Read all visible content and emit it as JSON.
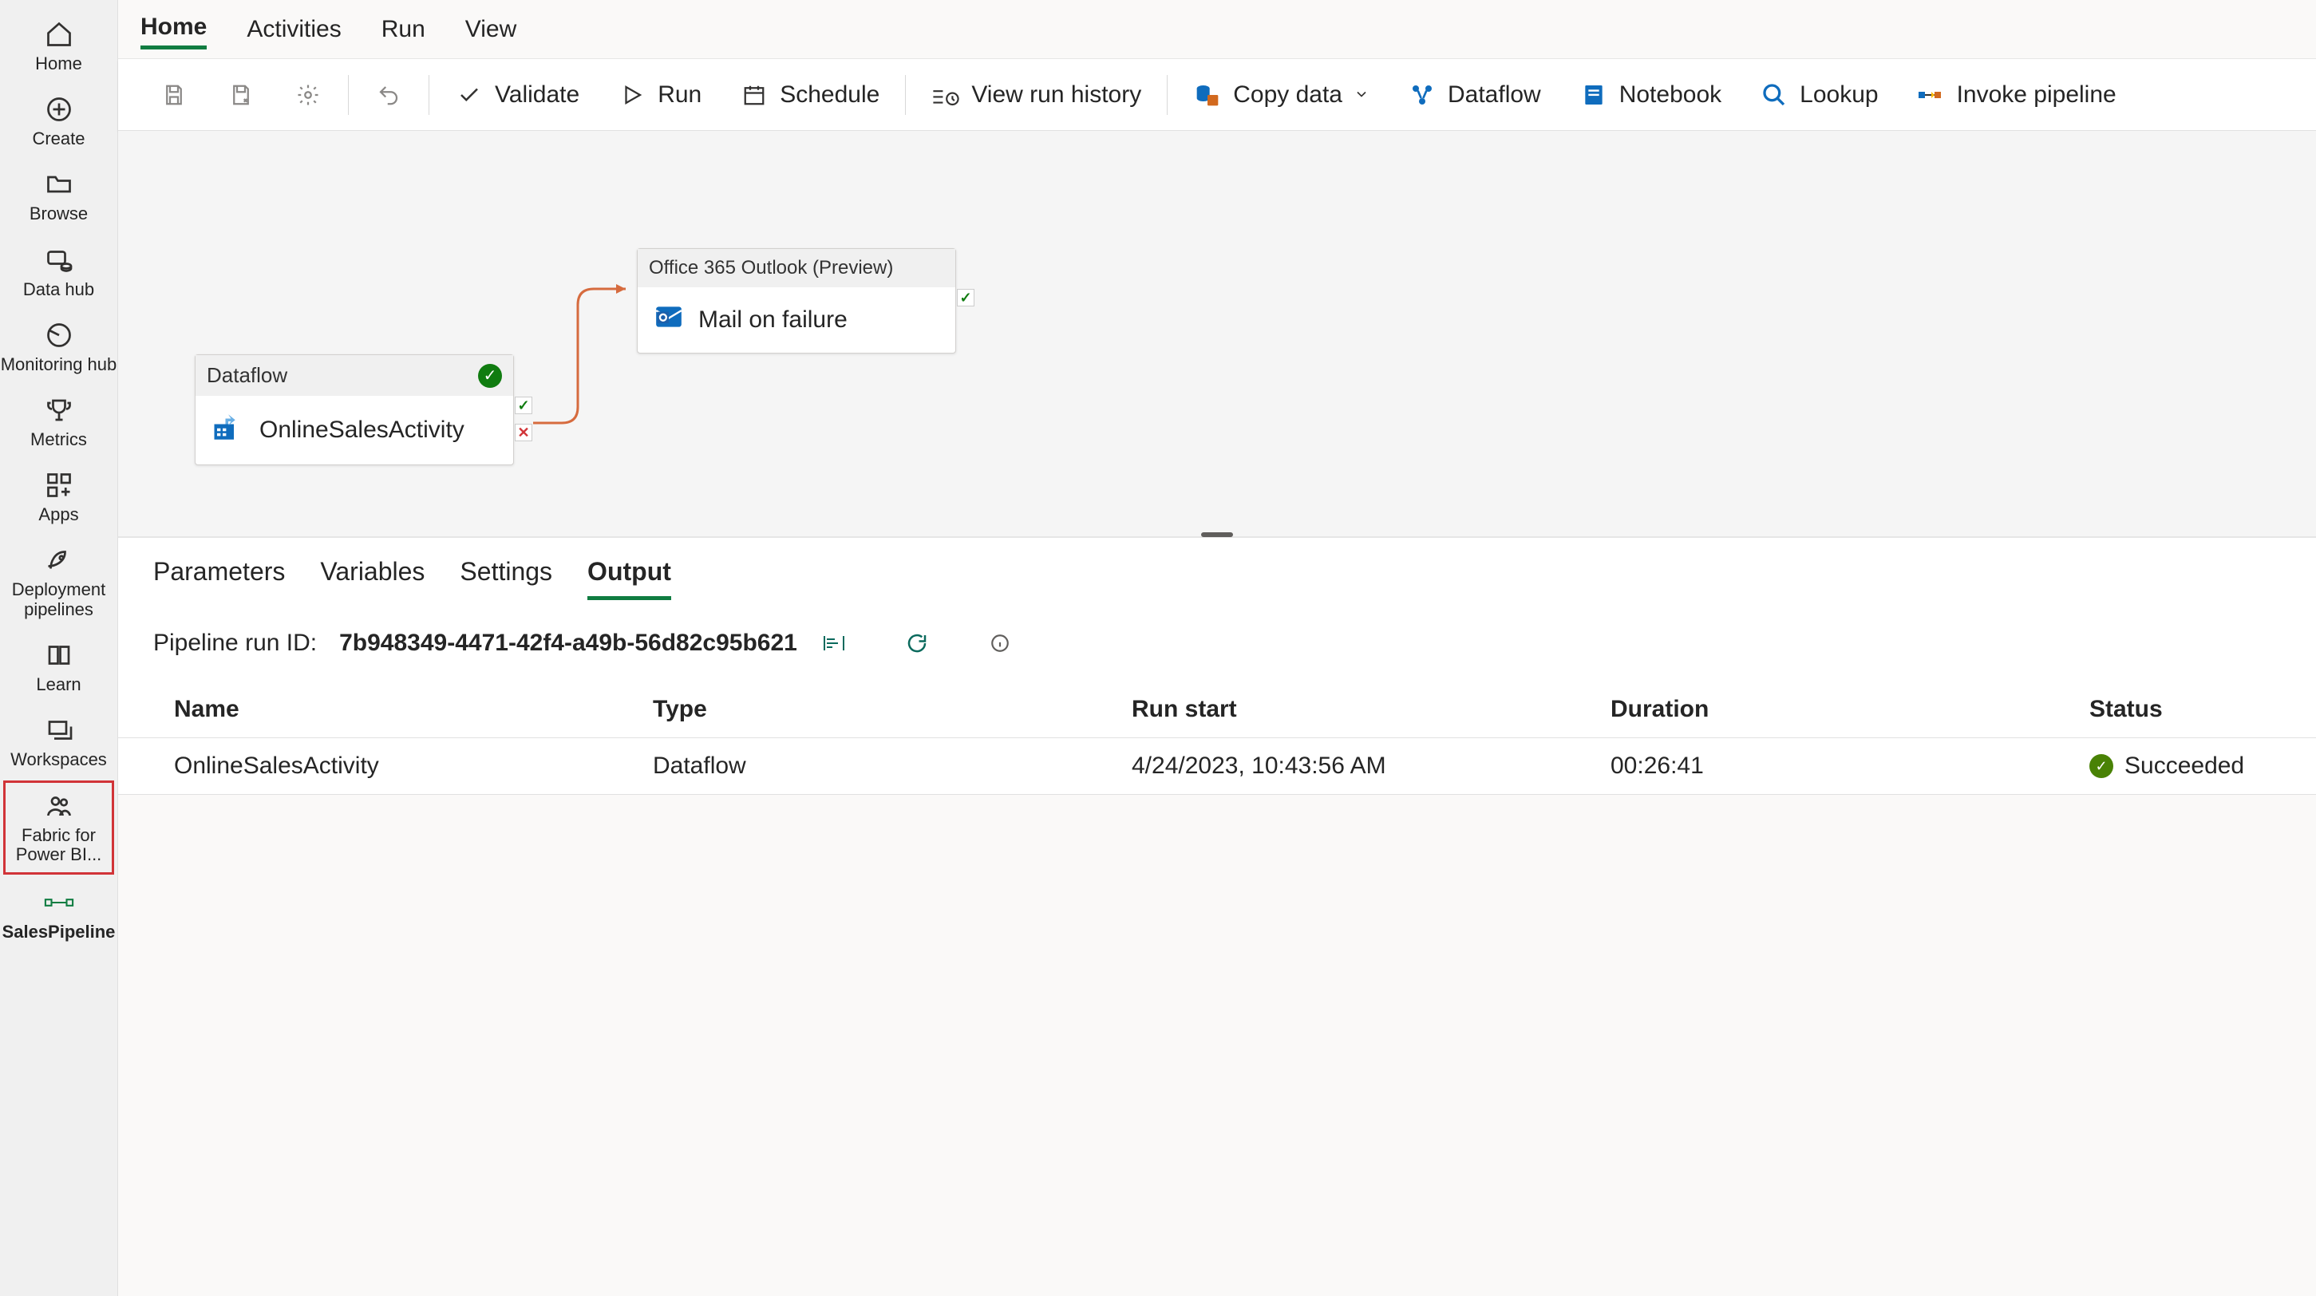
{
  "sidebar": {
    "items": [
      {
        "label": "Home"
      },
      {
        "label": "Create"
      },
      {
        "label": "Browse"
      },
      {
        "label": "Data hub"
      },
      {
        "label": "Monitoring hub"
      },
      {
        "label": "Metrics"
      },
      {
        "label": "Apps"
      },
      {
        "label": "Deployment pipelines"
      },
      {
        "label": "Learn"
      },
      {
        "label": "Workspaces"
      },
      {
        "label": "Fabric for Power BI..."
      },
      {
        "label": "SalesPipeline"
      }
    ]
  },
  "ribbon": {
    "tabs": [
      "Home",
      "Activities",
      "Run",
      "View"
    ]
  },
  "toolbar": {
    "validate": "Validate",
    "run": "Run",
    "schedule": "Schedule",
    "view_run_history": "View run history",
    "copy_data": "Copy data",
    "dataflow": "Dataflow",
    "notebook": "Notebook",
    "lookup": "Lookup",
    "invoke_pipeline": "Invoke pipeline"
  },
  "canvas": {
    "dataflow": {
      "type": "Dataflow",
      "name": "OnlineSalesActivity"
    },
    "mail": {
      "type": "Office 365 Outlook (Preview)",
      "name": "Mail on failure"
    }
  },
  "panel": {
    "tabs": [
      "Parameters",
      "Variables",
      "Settings",
      "Output"
    ],
    "run_id_label": "Pipeline run ID:",
    "run_id_value": "7b948349-4471-42f4-a49b-56d82c95b621",
    "columns": [
      "Name",
      "Type",
      "Run start",
      "Duration",
      "Status"
    ],
    "rows": [
      {
        "name": "OnlineSalesActivity",
        "type": "Dataflow",
        "run_start": "4/24/2023, 10:43:56 AM",
        "duration": "00:26:41",
        "status": "Succeeded"
      }
    ]
  }
}
